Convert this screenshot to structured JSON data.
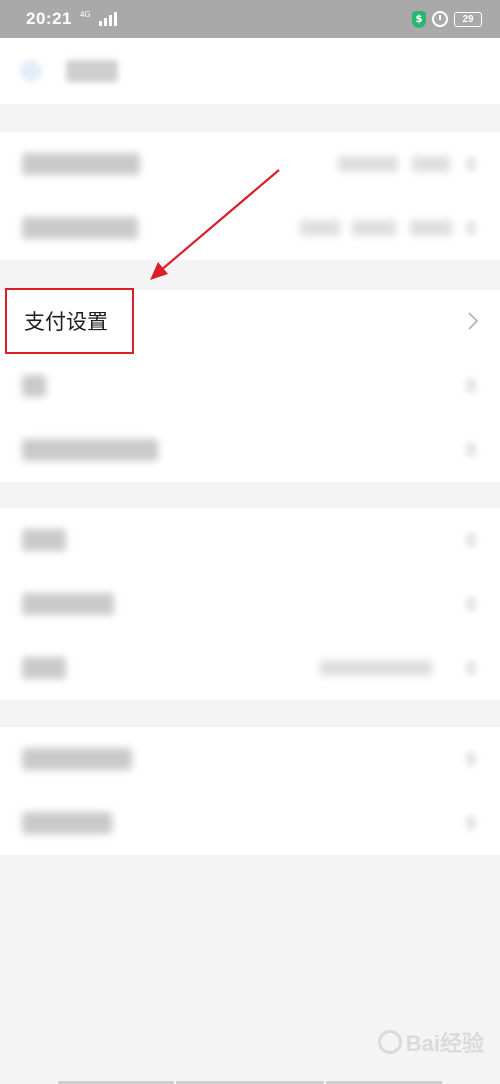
{
  "status_bar": {
    "time": "20:21",
    "network": "4G",
    "battery_level": "29",
    "shield_glyph": "$",
    "icons": [
      "signal-icon",
      "shield-icon",
      "alarm-icon",
      "battery-icon"
    ]
  },
  "header": {
    "back_icon": "back-icon"
  },
  "pay_settings": {
    "label": "支付设置",
    "chevron_icon": "chevron-right-icon"
  },
  "annotation": {
    "box_color": "#d9202a",
    "arrow_color": "#d9202a"
  },
  "watermark": {
    "text": "Bai经验",
    "logo_icon": "baidu-paw-icon"
  },
  "colors": {
    "status_bar_bg": "#a9a9a9",
    "page_bg": "#f4f4f4",
    "row_bg": "#ffffff"
  }
}
